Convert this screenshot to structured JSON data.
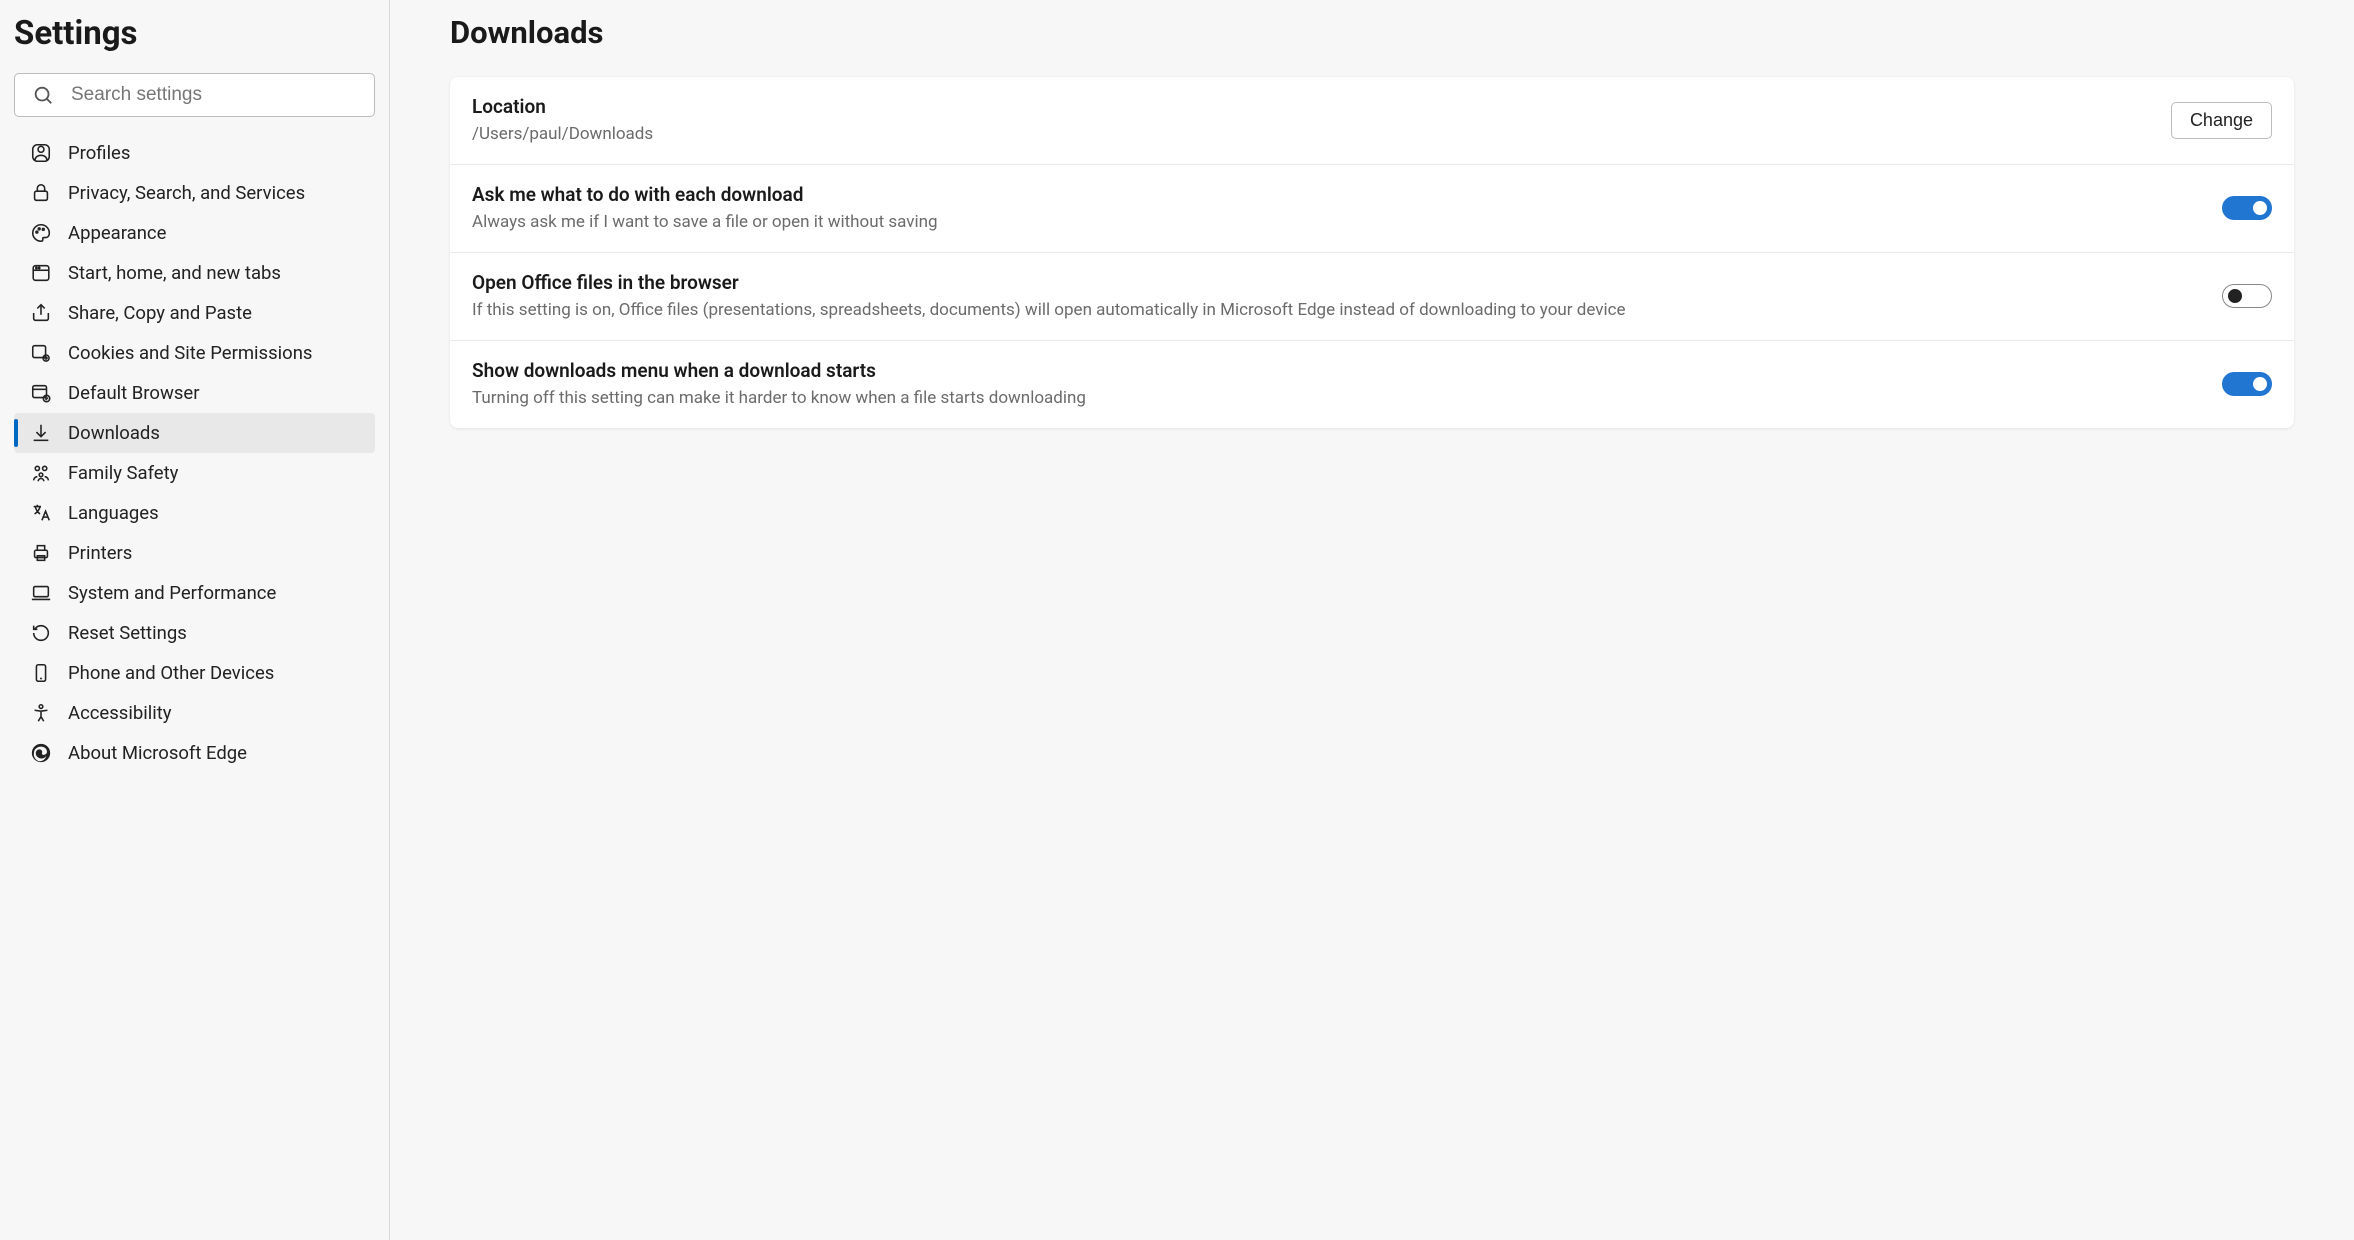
{
  "sidebar": {
    "title": "Settings",
    "search_placeholder": "Search settings",
    "items": [
      {
        "label": "Profiles"
      },
      {
        "label": "Privacy, Search, and Services"
      },
      {
        "label": "Appearance"
      },
      {
        "label": "Start, home, and new tabs"
      },
      {
        "label": "Share, Copy and Paste"
      },
      {
        "label": "Cookies and Site Permissions"
      },
      {
        "label": "Default Browser"
      },
      {
        "label": "Downloads"
      },
      {
        "label": "Family Safety"
      },
      {
        "label": "Languages"
      },
      {
        "label": "Printers"
      },
      {
        "label": "System and Performance"
      },
      {
        "label": "Reset Settings"
      },
      {
        "label": "Phone and Other Devices"
      },
      {
        "label": "Accessibility"
      },
      {
        "label": "About Microsoft Edge"
      }
    ]
  },
  "page": {
    "title": "Downloads",
    "location": {
      "title": "Location",
      "path": "/Users/paul/Downloads",
      "button": "Change"
    },
    "ask": {
      "title": "Ask me what to do with each download",
      "desc": "Always ask me if I want to save a file or open it without saving",
      "on": true
    },
    "office": {
      "title": "Open Office files in the browser",
      "desc": "If this setting is on, Office files (presentations, spreadsheets, documents) will open automatically in Microsoft Edge instead of downloading to your device",
      "on": false
    },
    "menu": {
      "title": "Show downloads menu when a download starts",
      "desc": "Turning off this setting can make it harder to know when a file starts downloading",
      "on": true
    }
  }
}
